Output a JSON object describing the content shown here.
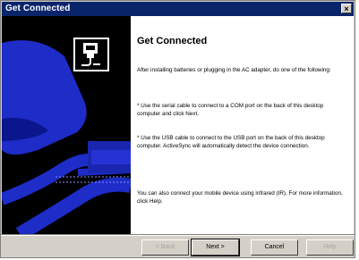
{
  "window": {
    "title": "Get Connected",
    "close_glyph": "×"
  },
  "art": {
    "icon": "device-cradle-icon",
    "accent_color": "#1e2cc8",
    "background_color": "#000000"
  },
  "page": {
    "heading": "Get Connected",
    "intro": "After installing batteries or plugging in the AC adapter, do one of the following:",
    "bullets": [
      "* Use the serial cable to connect to a COM port on the back of this desktop computer and click Next.",
      "* Use the USB cable to connect to the USB port on the back of this desktop computer.  ActiveSync will automatically detect the device connection."
    ],
    "footer_note": "You can also connect your mobile device using infrared (IR). For more information, click Help."
  },
  "buttons": {
    "back": "< Back",
    "next": "Next >",
    "cancel": "Cancel",
    "help": "Help"
  }
}
